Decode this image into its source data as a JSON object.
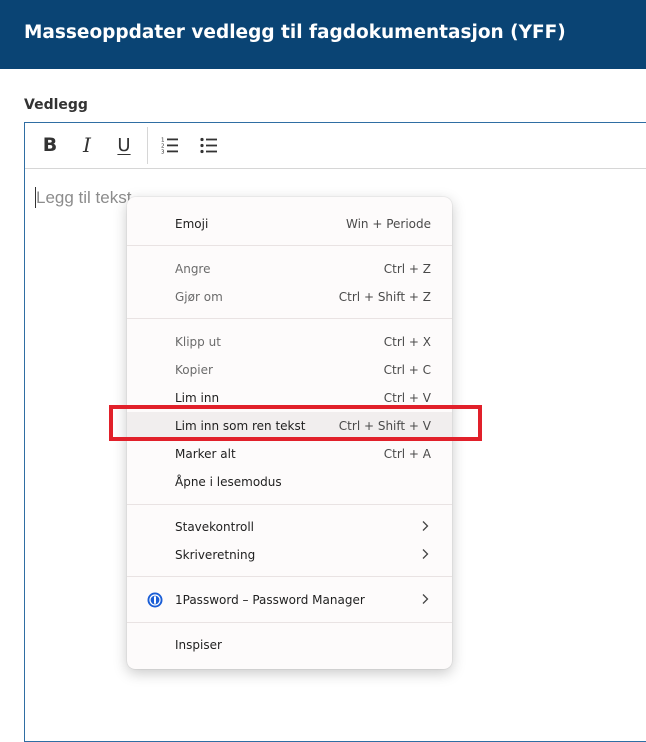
{
  "header": {
    "title": "Masseoppdater vedlegg til fagdokumentasjon (YFF)"
  },
  "field": {
    "label": "Vedlegg"
  },
  "toolbar": {
    "bold": "B",
    "italic": "I",
    "underline": "U"
  },
  "editor": {
    "placeholder": "Legg til tekst"
  },
  "context_menu": {
    "emoji": {
      "label": "Emoji",
      "shortcut": "Win + Periode"
    },
    "undo": {
      "label": "Angre",
      "shortcut": "Ctrl + Z"
    },
    "redo": {
      "label": "Gjør om",
      "shortcut": "Ctrl + Shift + Z"
    },
    "cut": {
      "label": "Klipp ut",
      "shortcut": "Ctrl + X"
    },
    "copy": {
      "label": "Kopier",
      "shortcut": "Ctrl + C"
    },
    "paste": {
      "label": "Lim inn",
      "shortcut": "Ctrl + V"
    },
    "paste_plain": {
      "label": "Lim inn som ren tekst",
      "shortcut": "Ctrl + Shift + V"
    },
    "select_all": {
      "label": "Marker alt",
      "shortcut": "Ctrl + A"
    },
    "reading_mode": {
      "label": "Åpne i lesemodus"
    },
    "spellcheck": {
      "label": "Stavekontroll"
    },
    "writing_direction": {
      "label": "Skriveretning"
    },
    "password_manager": {
      "label": "1Password – Password Manager"
    },
    "inspect": {
      "label": "Inspiser"
    }
  },
  "colors": {
    "header_bg": "#0a4474",
    "highlight": "#e1202a",
    "editor_border": "#2f6ea3"
  }
}
